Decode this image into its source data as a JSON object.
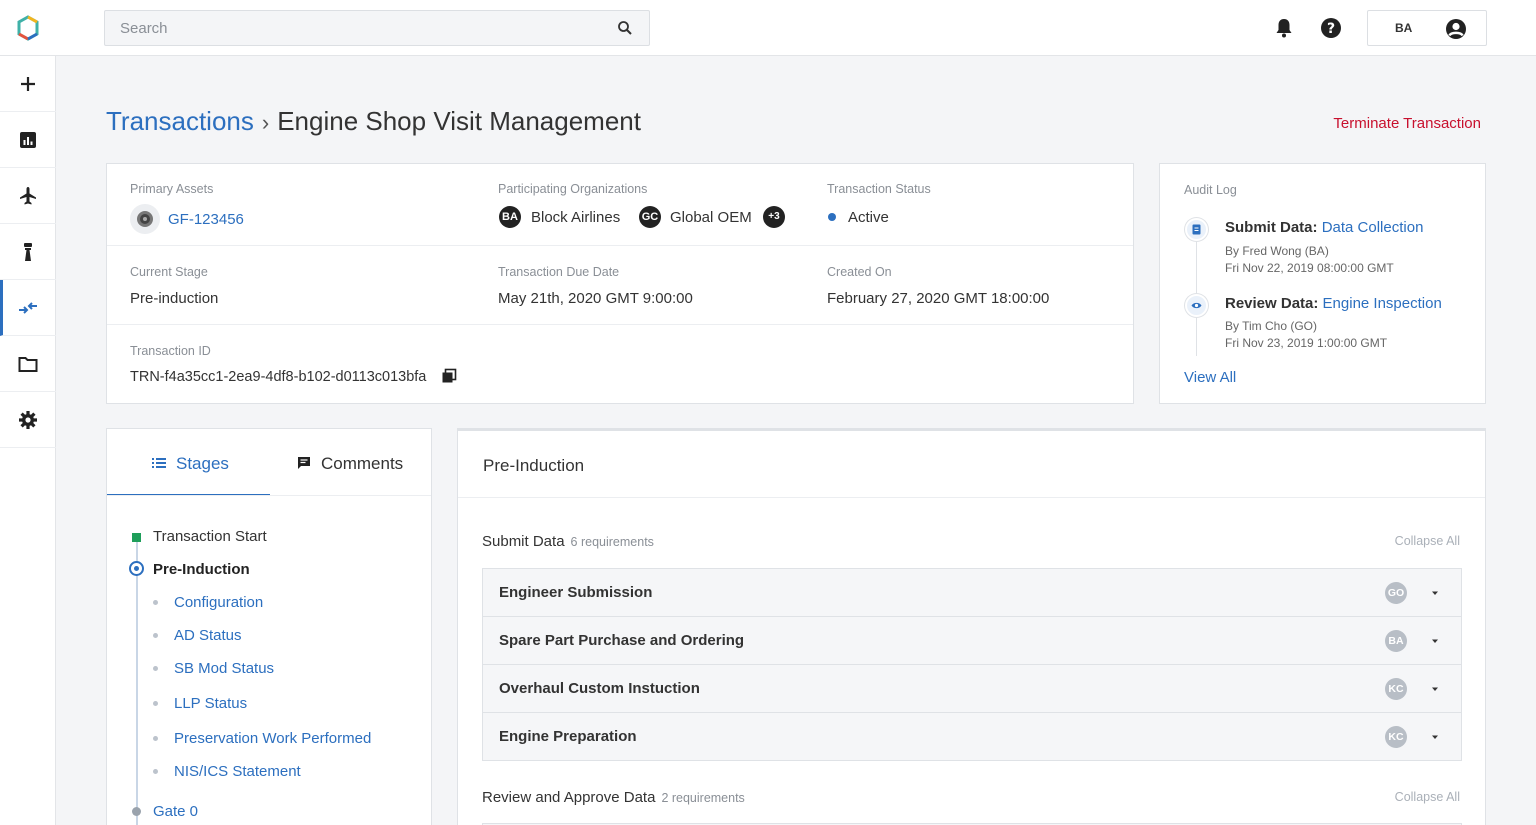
{
  "topbar": {
    "search_placeholder": "Search",
    "user_initials": "BA"
  },
  "sidebar": {
    "items": [
      "add-icon",
      "dashboard-icon",
      "airplane-icon",
      "tower-icon",
      "transactions-icon",
      "folder-icon",
      "gear-icon"
    ],
    "active_index": 4
  },
  "header": {
    "breadcrumb_root": "Transactions",
    "breadcrumb_sep": "›",
    "title": "Engine Shop Visit Management",
    "terminate_label": "Terminate Transaction"
  },
  "summary": {
    "primary_assets_label": "Primary Assets",
    "primary_asset": "GF-123456",
    "participating_label": "Participating Organizations",
    "orgs": [
      {
        "badge": "BA",
        "name": "Block Airlines"
      },
      {
        "badge": "GC",
        "name": "Global OEM"
      }
    ],
    "more_orgs": "+3",
    "status_label": "Transaction Status",
    "status": "Active",
    "current_stage_label": "Current Stage",
    "current_stage": "Pre-induction",
    "due_label": "Transaction Due Date",
    "due": "May 21th, 2020 GMT 9:00:00",
    "created_label": "Created On",
    "created": "February 27, 2020 GMT 18:00:00",
    "id_label": "Transaction ID",
    "id": "TRN-f4a35cc1-2ea9-4df8-b102-d0113c013bfa"
  },
  "audit": {
    "title": "Audit Log",
    "entries": [
      {
        "action": "Submit Data:",
        "target": "Data Collection",
        "by": "By Fred Wong (BA)",
        "time": "Fri Nov 22, 2019 08:00:00 GMT"
      },
      {
        "action": "Review Data:",
        "target": "Engine Inspection",
        "by": "By Tim Cho (GO)",
        "time": "Fri Nov 23, 2019 1:00:00 GMT"
      }
    ],
    "view_all": "View All"
  },
  "stages_panel": {
    "tab_stages": "Stages",
    "tab_comments": "Comments",
    "items": [
      {
        "label": "Transaction Start"
      },
      {
        "label": "Pre-Induction"
      },
      {
        "label": "Configuration"
      },
      {
        "label": "AD Status"
      },
      {
        "label": "SB Mod Status"
      },
      {
        "label": "LLP Status"
      },
      {
        "label": "Preservation Work Performed"
      },
      {
        "label": "NIS/ICS Statement"
      },
      {
        "label": "Gate 0"
      }
    ]
  },
  "requirements": {
    "title": "Pre-Induction",
    "submit_section": "Submit Data",
    "submit_count": "6 requirements",
    "collapse_all": "Collapse All",
    "rows": [
      {
        "name": "Engineer Submission",
        "org": "GO"
      },
      {
        "name": "Spare Part Purchase and Ordering",
        "org": "BA"
      },
      {
        "name": "Overhaul Custom Instuction",
        "org": "KC"
      },
      {
        "name": "Engine Preparation",
        "org": "KC"
      }
    ],
    "review_section": "Review and Approve Data",
    "review_count": "2 requirements"
  }
}
